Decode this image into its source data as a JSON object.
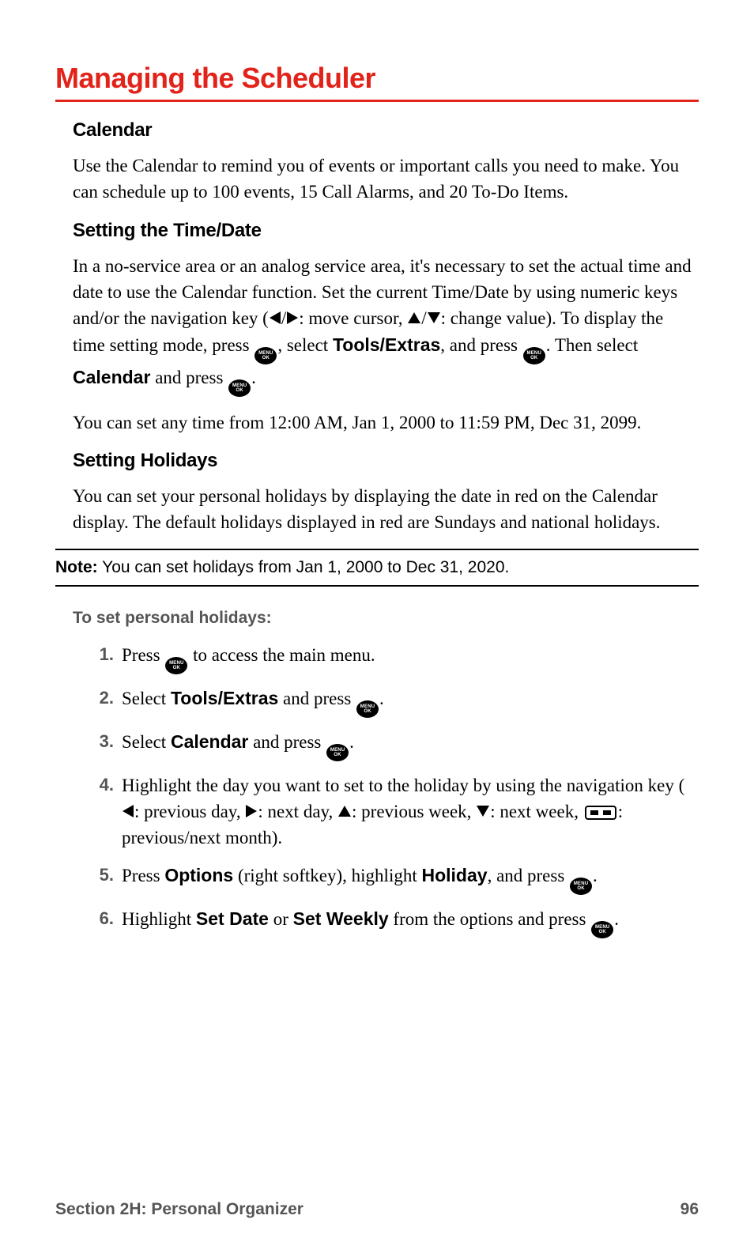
{
  "title": "Managing the Scheduler",
  "sections": {
    "calendar": {
      "heading": "Calendar",
      "p1": "Use the Calendar to remind you of events or important calls you need to make. You can schedule up to 100 events, 15 Call Alarms, and 20 To-Do Items."
    },
    "timedate": {
      "heading": "Setting the Time/Date",
      "p1a": "In a no-service area or an analog service area, it's necessary to set the actual time and date to use the Calendar function. Set the current Time/Date by using numeric keys and/or the navigation key (",
      "p1b": ": move cursor, ",
      "p1c": ": change value). To display the time setting mode, press ",
      "p1d": ", select ",
      "tools_extras": "Tools/Extras",
      "p1e": ", and press ",
      "p1f": ". Then select ",
      "calendar_bold": "Calendar",
      "p1g": " and press ",
      "p1h": ".",
      "p2": "You can set any time from 12:00 AM, Jan 1, 2000 to 11:59 PM, Dec 31, 2099."
    },
    "holidays": {
      "heading": "Setting Holidays",
      "p1": "You can set your personal holidays by displaying the date in red on the Calendar display. The default holidays displayed in red are Sundays and national holidays."
    }
  },
  "note": {
    "label": "Note:",
    "text": " You can set holidays from Jan 1, 2000 to Dec 31, 2020."
  },
  "steps_lead": "To set personal holidays:",
  "steps": {
    "s1": {
      "num": "1.",
      "a": "Press ",
      "b": " to access the main menu."
    },
    "s2": {
      "num": "2.",
      "a": "Select ",
      "bold": "Tools/Extras",
      "b": " and press ",
      "c": "."
    },
    "s3": {
      "num": "3.",
      "a": "Select ",
      "bold": "Calendar",
      "b": " and press ",
      "c": "."
    },
    "s4": {
      "num": "4.",
      "a": "Highlight the day you want to set to the holiday by using the navigation key (",
      "b": ": previous day, ",
      "c": ": next day, ",
      "d": ": previous week, ",
      "e": ": next week, ",
      "f": ": previous/next month)."
    },
    "s5": {
      "num": "5.",
      "a": "Press ",
      "bold1": "Options",
      "b": " (right softkey), highlight ",
      "bold2": "Holiday",
      "c": ", and press ",
      "d": "."
    },
    "s6": {
      "num": "6.",
      "a": "Highlight ",
      "bold1": "Set Date",
      "b": " or ",
      "bold2": "Set Weekly",
      "c": " from the options and press ",
      "d": "."
    }
  },
  "footer": {
    "left": "Section 2H: Personal Organizer",
    "right": "96"
  },
  "icons": {
    "menu_ok": "MENU\nOK"
  }
}
